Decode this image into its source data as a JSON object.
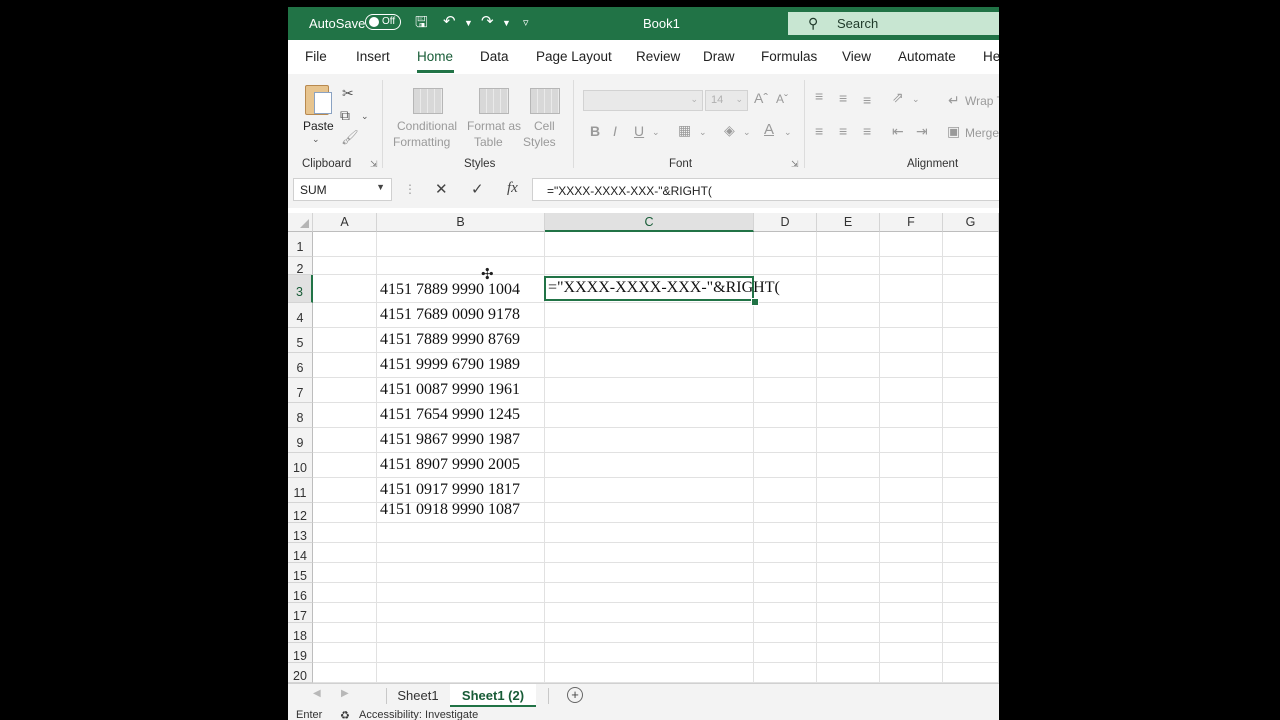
{
  "titlebar": {
    "autosave_label": "AutoSave",
    "autosave_state": "Off",
    "book_title": "Book1",
    "search_label": "Search"
  },
  "tabs": [
    "File",
    "Insert",
    "Home",
    "Data",
    "Page Layout",
    "Review",
    "Draw",
    "Formulas",
    "View",
    "Automate",
    "He"
  ],
  "active_tab": "Home",
  "ribbon": {
    "clipboard": {
      "paste_label": "Paste",
      "group_label": "Clipboard"
    },
    "styles": {
      "conditional_formatting": [
        "Conditional",
        "Formatting"
      ],
      "format_as_table": [
        "Format as",
        "Table"
      ],
      "cell_styles": [
        "Cell",
        "Styles"
      ],
      "group_label": "Styles"
    },
    "font": {
      "font_size": "14",
      "group_label": "Font"
    },
    "alignment": {
      "wrap_label": "Wrap T",
      "merge_label": "Merge",
      "group_label": "Alignment"
    }
  },
  "formula_bar": {
    "name_box": "SUM",
    "formula": "=\"XXXX-XXXX-XXX-\"&RIGHT("
  },
  "grid": {
    "columns": [
      "A",
      "B",
      "C",
      "D",
      "E",
      "F",
      "G"
    ],
    "selected_column": "C",
    "rows": [
      "1",
      "2",
      "3",
      "4",
      "5",
      "6",
      "7",
      "8",
      "9",
      "10",
      "11",
      "12",
      "13",
      "14",
      "15",
      "16",
      "17",
      "18",
      "19",
      "20"
    ],
    "selected_row": "3",
    "column_b_values": [
      "4151 7889 9990 1004",
      "4151 7689 0090 9178",
      "4151 7889 9990 8769",
      "4151 9999 6790 1989",
      "4151 0087 9990 1961",
      "4151 7654 9990 1245",
      "4151 9867 9990 1987",
      "4151 8907 9990 2005",
      "4151 0917 9990 1817",
      "4151 0918 9990 1087"
    ],
    "active_cell_text": "=\"XXXX-XXXX-XXX-\"&RIGHT("
  },
  "sheets": [
    "Sheet1",
    "Sheet1 (2)"
  ],
  "active_sheet": "Sheet1 (2)",
  "statusbar": {
    "mode": "Enter",
    "accessibility": "Accessibility: Investigate"
  },
  "colors": {
    "accent": "#217346",
    "search_bg": "#c8e6d2"
  }
}
